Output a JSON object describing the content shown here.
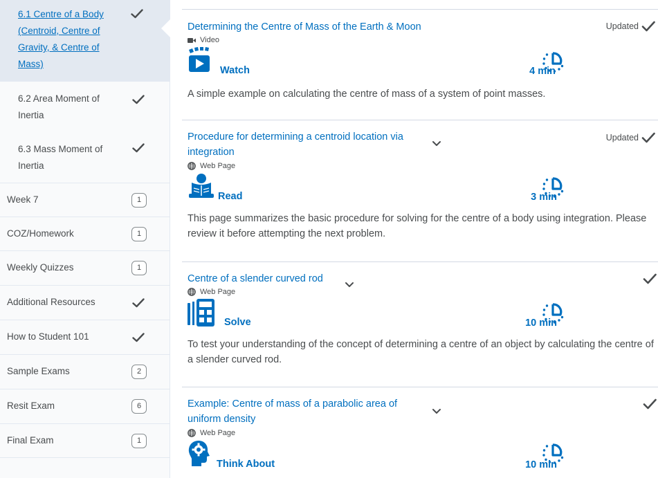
{
  "sidebar": {
    "sub_items": [
      {
        "label": "6.1 Centre of a Body (Centroid, Centre of Gravity, & Centre of Mass)",
        "completed": true
      },
      {
        "label": "6.2 Area Moment of Inertia",
        "completed": true
      },
      {
        "label": "6.3 Mass Moment of Inertia",
        "completed": true
      }
    ],
    "modules": [
      {
        "label": "Week 7",
        "badge": "1"
      },
      {
        "label": "COZ/Homework",
        "badge": "1"
      },
      {
        "label": "Weekly Quizzes",
        "badge": "1"
      },
      {
        "label": "Additional Resources",
        "badge": null
      },
      {
        "label": "How to Student 101",
        "badge": null
      },
      {
        "label": "Sample Exams",
        "badge": "2"
      },
      {
        "label": "Resit Exam",
        "badge": "6"
      },
      {
        "label": "Final Exam",
        "badge": "1"
      }
    ]
  },
  "topics": [
    {
      "title": "Determining the Centre of Mass of the Earth & Moon",
      "type": "Video",
      "type_icon": "video-camera-icon",
      "activity": "Watch",
      "activity_icon": "clapperboard-play-icon",
      "duration": "4 min",
      "status": "Updated",
      "description": "A simple example on calculating the centre of mass of a system of point masses."
    },
    {
      "title": "Procedure for determining a centroid location via integration",
      "type": "Web Page",
      "type_icon": "globe-icon",
      "activity": "Read",
      "activity_icon": "person-reading-icon",
      "duration": "3 min",
      "status": "Updated",
      "description": "This page summarizes the basic procedure for solving for the centre of a body using integration. Please review it before attempting the next problem."
    },
    {
      "title": "Centre of a slender curved rod",
      "type": "Web Page",
      "type_icon": "globe-icon",
      "activity": "Solve",
      "activity_icon": "calculator-icon",
      "duration": "10 min",
      "status": "",
      "description": "To test your understanding of the concept of determining a centre of an object by calculating the centre of a slender curved rod."
    },
    {
      "title": "Example: Centre of mass of a parabolic area of uniform density",
      "type": "Web Page",
      "type_icon": "globe-icon",
      "activity": "Think About",
      "activity_icon": "head-gear-icon",
      "duration": "10 min",
      "status": "",
      "description": ""
    }
  ],
  "colors": {
    "link": "#006fbf",
    "text": "#494c4e",
    "divider": "#d3d9e3",
    "sidebar_bg": "#f9fafb",
    "sidebar_active": "#e3e9f1"
  }
}
